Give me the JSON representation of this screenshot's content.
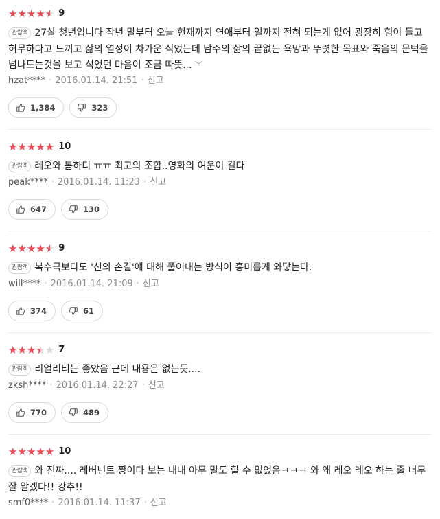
{
  "reviews": [
    {
      "rating": 9,
      "stars": "★★★★★",
      "score": "9",
      "badge": "관람객",
      "text": "27살 청년입니다 작년 말부터 오늘 현재까지 연애부터 일까지 전혀 되는게 없어 굉장히 힘이 들고 허무하다고 느끼고 삶의 열정이 차가운 식었는데 남주의 삶의 끝없는 욕망과 뚜렷한 목표와 죽음의 문턱을 넘나드는것을 보고 식었던 마음이 조금 따뜻...",
      "more": "﹀",
      "user": "hzat****",
      "date": "2016.01.14. 21:51",
      "report": "신고",
      "likes": "1,384",
      "dislikes": "323"
    },
    {
      "rating": 10,
      "stars": "★★★★★",
      "score": "10",
      "badge": "관람객",
      "text": "레오와 톰하디 ㅠㅠ 최고의 조합..영화의 여운이 길다",
      "user": "peak****",
      "date": "2016.01.14. 11:23",
      "report": "신고",
      "likes": "647",
      "dislikes": "130"
    },
    {
      "rating": 9,
      "stars": "★★★★★",
      "score": "9",
      "badge": "관람객",
      "text": "복수극보다도 '신의 손길'에 대해 풀어내는 방식이 흥미롭게 와닿는다.",
      "user": "will****",
      "date": "2016.01.14. 21:09",
      "report": "신고",
      "likes": "374",
      "dislikes": "61"
    },
    {
      "rating": 7,
      "stars": "★★★★★",
      "score": "7",
      "badge": "관람객",
      "text": "리얼리티는 좋았음 근데 내용은 없는듯....",
      "user": "zksh****",
      "date": "2016.01.14. 22:27",
      "report": "신고",
      "likes": "770",
      "dislikes": "489"
    },
    {
      "rating": 10,
      "stars": "★★★★★",
      "score": "10",
      "badge": "관람객",
      "text": "와 진짜.... 레버넌트 짱이다 보는 내내 아무 말도 할 수 없었음ㅋㅋㅋ 와 왜 레오 레오 하는 줄 너무 잘 알겠다!! 강추!!",
      "user": "smf0****",
      "date": "2016.01.14. 11:37",
      "report": "신고"
    }
  ],
  "icons": {
    "like": "thumbs-up-icon",
    "dislike": "thumbs-down-icon",
    "expand": "chevron-down-icon"
  },
  "colors": {
    "star": "#ea4b56",
    "star_empty": "#d6d6d6"
  }
}
